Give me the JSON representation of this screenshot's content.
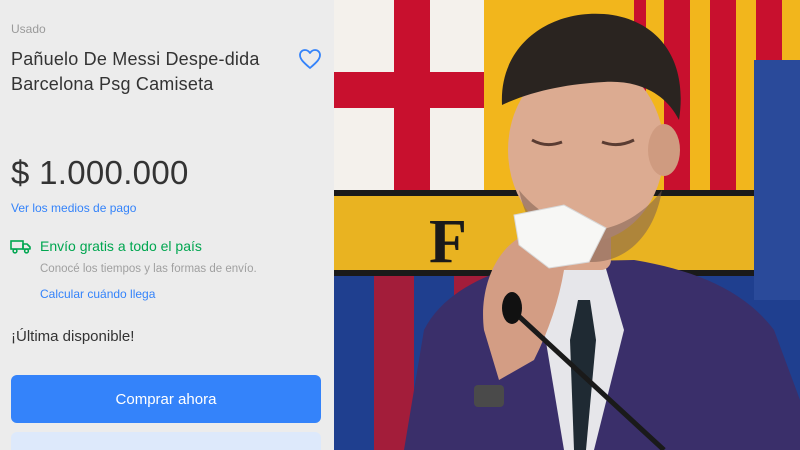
{
  "listing": {
    "condition": "Usado",
    "title": "Pañuelo De Messi Despe-dida Barcelona Psg Camiseta",
    "price": "$ 1.000.000",
    "payment_link": "Ver los medios de pago",
    "shipping": {
      "title": "Envío gratis a todo el país",
      "subtitle": "Conocé los tiempos y las formas de envío.",
      "calc_link": "Calcular cuándo llega",
      "icon": "truck-icon"
    },
    "stock_note": "¡Última disponible!",
    "buy_button": "Comprar ahora",
    "favorite_icon": "heart-icon"
  },
  "photo": {
    "crest_letter": "F"
  },
  "colors": {
    "accent_blue": "#3483fa",
    "shipping_green": "#00a650",
    "panel_bg": "#ececec",
    "crest_yellow": "#f2b61c",
    "crest_red": "#c8102e",
    "crest_blue": "#1f3f8f"
  }
}
